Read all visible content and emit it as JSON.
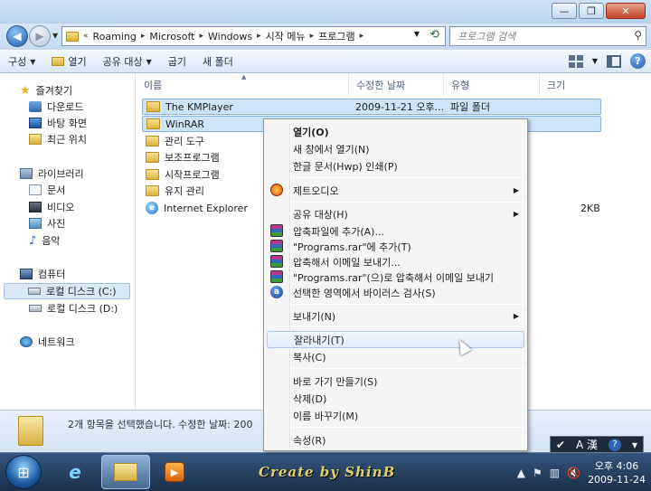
{
  "window": {
    "minimize_label": "—",
    "maximize_label": "❐",
    "close_label": "✕"
  },
  "address": {
    "path": [
      "Roaming",
      "Microsoft",
      "Windows",
      "시작 메뉴",
      "프로그램"
    ],
    "search_placeholder": "프로그램 검색"
  },
  "toolbar": {
    "organize": "구성",
    "open": "열기",
    "share": "공유 대상",
    "burn": "굽기",
    "new_folder": "새 폴더"
  },
  "navpane": {
    "favorites": "즐겨찾기",
    "downloads": "다운로드",
    "desktop": "바탕 화면",
    "recent": "최근 위치",
    "libraries": "라이브러리",
    "documents": "문서",
    "videos": "비디오",
    "pictures": "사진",
    "music": "음악",
    "computer": "컴퓨터",
    "drive_c": "로컬 디스크 (C:)",
    "drive_d": "로컬 디스크 (D:)",
    "network": "네트워크"
  },
  "columns": {
    "name": "이름",
    "modified": "수정한 날짜",
    "type": "유형",
    "size": "크기"
  },
  "files": [
    {
      "name": "The KMPlayer",
      "modified": "2009-11-21 오후...",
      "type": "파일 폴더",
      "size": "",
      "selected": true
    },
    {
      "name": "WinRAR",
      "modified": "",
      "type": "",
      "size": "",
      "selected": true
    },
    {
      "name": "관리 도구",
      "modified": "",
      "type": "",
      "size": "",
      "selected": false
    },
    {
      "name": "보조프로그램",
      "modified": "",
      "type": "",
      "size": "",
      "selected": false
    },
    {
      "name": "시작프로그램",
      "modified": "",
      "type": "",
      "size": "",
      "selected": false
    },
    {
      "name": "유지 관리",
      "modified": "",
      "type": "",
      "size": "",
      "selected": false
    },
    {
      "name": "Internet Explorer",
      "modified": "",
      "type": "",
      "size": "2KB",
      "selected": false
    }
  ],
  "details": {
    "text": "2개 항목을 선택했습니다.  수정한 날짜: 200"
  },
  "context_menu": {
    "open": "열기(O)",
    "open_new_window": "새 창에서 열기(N)",
    "hwp_print": "한글 문서(Hwp) 인쇄(P)",
    "jetaudio": "제트오디오",
    "share": "공유 대상(H)",
    "add_archive": "압축파일에 추가(A)...",
    "add_programs_rar": "\"Programs.rar\"에 추가(T)",
    "compress_email": "압축해서 이메일 보내기...",
    "compress_programs_email": "\"Programs.rar\"(으)로 압축해서 이메일 보내기",
    "virus_scan": "선택한 영역에서 바이러스 검사(S)",
    "send_to": "보내기(N)",
    "cut": "잘라내기(T)",
    "copy": "복사(C)",
    "create_shortcut": "바로 가기 만들기(S)",
    "delete": "삭제(D)",
    "rename": "이름 바꾸기(M)",
    "properties": "속성(R)"
  },
  "taskbar": {
    "watermark": "Create by ShinB",
    "ime_label": "A 漢",
    "time": "오후 4:06",
    "date": "2009-11-24"
  },
  "colors": {
    "selection": "#cce3f8",
    "menu_hover": "#e1ecf9",
    "taskbar": "#1a2f4b",
    "watermark": "#e3d26a"
  }
}
